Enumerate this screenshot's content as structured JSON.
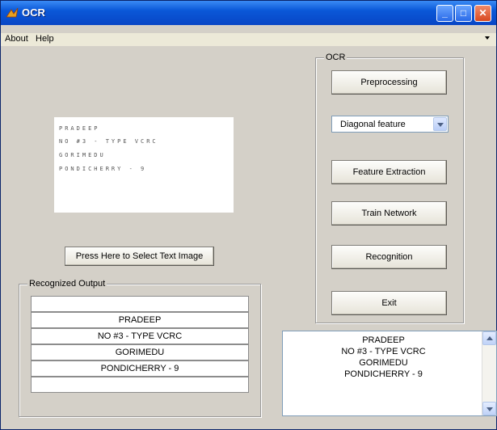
{
  "window": {
    "title": "OCR",
    "controls": {
      "minimize": "_",
      "maximize": "□",
      "close": "✕"
    }
  },
  "menu": {
    "items": [
      "About",
      "Help"
    ]
  },
  "input_image": {
    "lines": [
      "PRADEEP",
      "NO #3 - TYPE VCRC",
      "GORIMEDU",
      "PONDICHERRY - 9"
    ]
  },
  "select_button_label": "Press Here to Select Text Image",
  "recognized_output": {
    "title": "Recognized Output",
    "rows": [
      "",
      "PRADEEP",
      "NO #3 - TYPE VCRC",
      "GORIMEDU",
      "PONDICHERRY - 9",
      ""
    ]
  },
  "ocr_panel": {
    "title": "OCR",
    "preprocessing_label": "Preprocessing",
    "feature_select_value": "Diagonal feature",
    "feature_extraction_label": "Feature Extraction",
    "train_network_label": "Train Network",
    "recognition_label": "Recognition",
    "exit_label": "Exit"
  },
  "result_text": {
    "lines": [
      "PRADEEP",
      "NO #3 - TYPE VCRC",
      "GORIMEDU",
      "PONDICHERRY - 9"
    ]
  },
  "colors": {
    "titlebar": "#0a58d8",
    "window_bg": "#d4d0c8"
  }
}
